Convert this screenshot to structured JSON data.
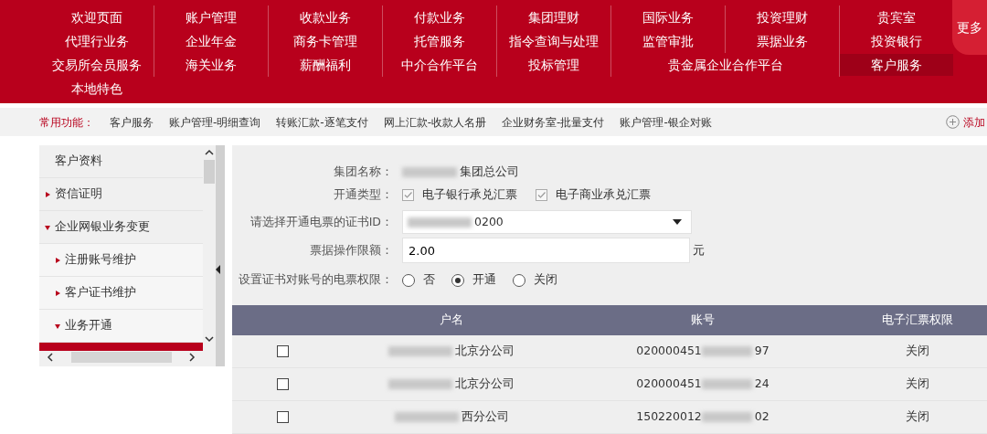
{
  "top_menu": {
    "items": [
      {
        "label": "欢迎页面",
        "selected": false
      },
      {
        "label": "账户管理",
        "selected": false
      },
      {
        "label": "收款业务",
        "selected": false
      },
      {
        "label": "付款业务",
        "selected": false
      },
      {
        "label": "集团理财",
        "selected": false
      },
      {
        "label": "国际业务",
        "selected": false
      },
      {
        "label": "投资理财",
        "selected": false
      },
      {
        "label": "贵宾室",
        "selected": false
      },
      {
        "label": "代理行业务",
        "selected": false
      },
      {
        "label": "企业年金",
        "selected": false
      },
      {
        "label": "商务卡管理",
        "selected": false
      },
      {
        "label": "托管服务",
        "selected": false
      },
      {
        "label": "指令查询与处理",
        "selected": false
      },
      {
        "label": "监管审批",
        "selected": false
      },
      {
        "label": "票据业务",
        "selected": false
      },
      {
        "label": "投资银行",
        "selected": false
      },
      {
        "label": "交易所会员服务",
        "selected": false
      },
      {
        "label": "海关业务",
        "selected": false
      },
      {
        "label": "薪酬福利",
        "selected": false
      },
      {
        "label": "中介合作平台",
        "selected": false
      },
      {
        "label": "投标管理",
        "selected": false
      },
      {
        "label": "贵金属企业合作平台",
        "selected": false,
        "wide": true
      },
      {
        "label": "客户服务",
        "selected": true
      },
      {
        "label": "本地特色",
        "selected": false
      }
    ],
    "more_button": "更多"
  },
  "quick_bar": {
    "label": "常用功能：",
    "links": [
      "客户服务",
      "账户管理-明细查询",
      "转账汇款-逐笔支付",
      "网上汇款-收款人名册",
      "企业财务室-批量支付",
      "账户管理-银企对账"
    ],
    "add_link": "添加"
  },
  "sidebar": {
    "items": [
      {
        "label": "客户资料"
      },
      {
        "label": "资信证明",
        "expanded": false
      },
      {
        "label": "企业网银业务变更",
        "expanded": true,
        "children": [
          {
            "label": "注册账号维护",
            "expanded": false
          },
          {
            "label": "客户证书维护",
            "expanded": false
          },
          {
            "label": "业务开通",
            "expanded": true
          }
        ]
      }
    ]
  },
  "form": {
    "fields": [
      {
        "kind": "text",
        "label": "集团名称：",
        "value": "集团总公司"
      },
      {
        "kind": "checkboxes",
        "label": "开通类型：",
        "options": [
          {
            "label": "电子银行承兑汇票",
            "checked": true
          },
          {
            "label": "电子商业承兑汇票",
            "checked": true
          }
        ]
      },
      {
        "kind": "select",
        "label": "请选择开通电票的证书ID：",
        "value": "0200"
      },
      {
        "kind": "amount",
        "label": "票据操作限额：",
        "value": "2.00",
        "unit": "元"
      },
      {
        "kind": "radios",
        "label": "设置证书对账号的电票权限：",
        "options": [
          {
            "label": "否",
            "selected": false
          },
          {
            "label": "开通",
            "selected": true
          },
          {
            "label": "关闭",
            "selected": false
          }
        ]
      }
    ]
  },
  "table": {
    "columns": [
      "户名",
      "账号",
      "电子汇票权限"
    ],
    "rows": [
      {
        "checked": false,
        "name": "北京分公司",
        "account_start": "020000451",
        "account_end": "97",
        "permission": "关闭"
      },
      {
        "checked": false,
        "name": "北京分公司",
        "account_start": "020000451",
        "account_end": "24",
        "permission": "关闭"
      },
      {
        "checked": false,
        "name": "西分公司",
        "account_start": "150220012",
        "account_end": "02",
        "permission": "关闭"
      }
    ]
  }
}
